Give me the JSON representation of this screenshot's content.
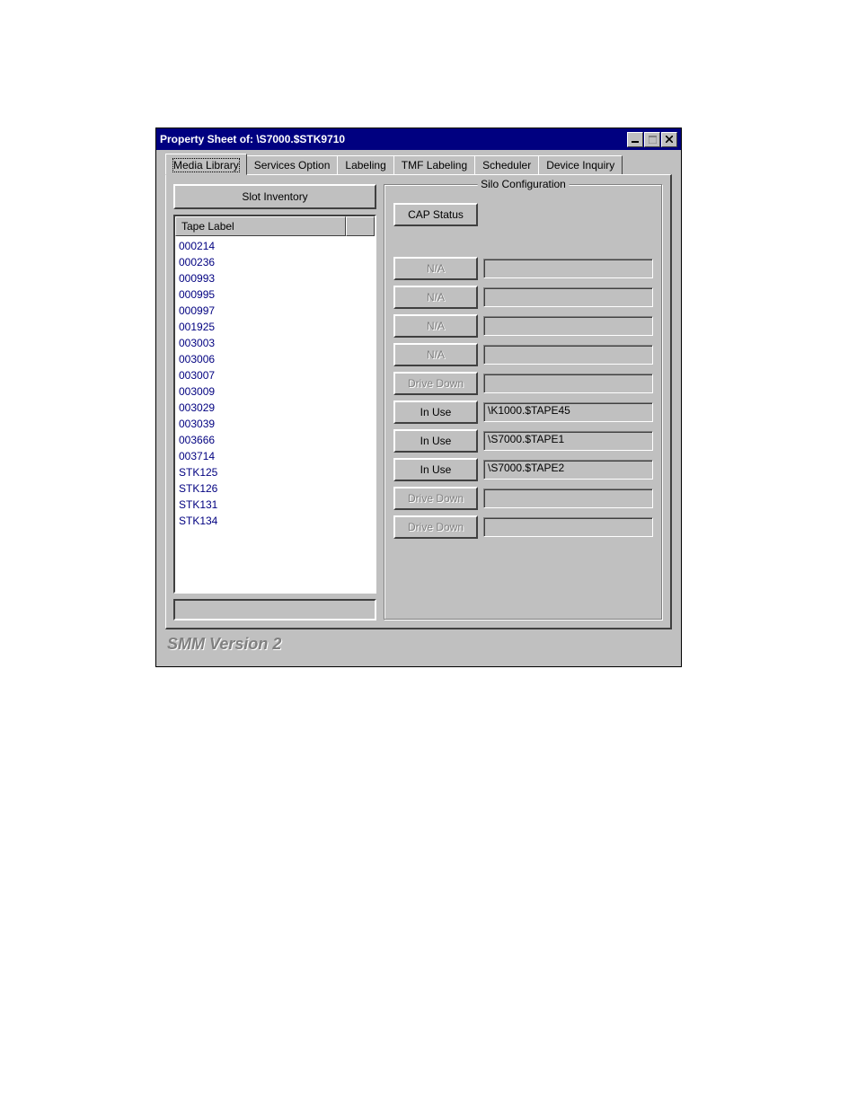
{
  "window": {
    "title": "Property Sheet of: \\S7000.$STK9710"
  },
  "tabs": [
    {
      "label": "Media Library",
      "active": true
    },
    {
      "label": "Services Option",
      "active": false
    },
    {
      "label": "Labeling",
      "active": false
    },
    {
      "label": "TMF Labeling",
      "active": false
    },
    {
      "label": "Scheduler",
      "active": false
    },
    {
      "label": "Device Inquiry",
      "active": false
    }
  ],
  "left": {
    "slot_inventory_button": "Slot Inventory",
    "column_header": "Tape Label",
    "items": [
      "000214",
      "000236",
      "000993",
      "000995",
      "000997",
      "001925",
      "003003",
      "003006",
      "003007",
      "003009",
      "003029",
      "003039",
      "003666",
      "003714",
      "STK125",
      "STK126",
      "STK131",
      "STK134"
    ]
  },
  "right": {
    "group_label": "Silo Configuration",
    "cap_status_button": "CAP Status",
    "rows": [
      {
        "status": "N/A",
        "value": "",
        "disabled": true
      },
      {
        "status": "N/A",
        "value": "",
        "disabled": true
      },
      {
        "status": "N/A",
        "value": "",
        "disabled": true
      },
      {
        "status": "N/A",
        "value": "",
        "disabled": true
      },
      {
        "status": "Drive Down",
        "value": "",
        "disabled": true
      },
      {
        "status": "In Use",
        "value": "\\K1000.$TAPE45",
        "disabled": false
      },
      {
        "status": "In Use",
        "value": "\\S7000.$TAPE1",
        "disabled": false
      },
      {
        "status": "In Use",
        "value": "\\S7000.$TAPE2",
        "disabled": false
      },
      {
        "status": "Drive Down",
        "value": "",
        "disabled": true
      },
      {
        "status": "Drive Down",
        "value": "",
        "disabled": true
      }
    ]
  },
  "footer": "SMM Version 2"
}
